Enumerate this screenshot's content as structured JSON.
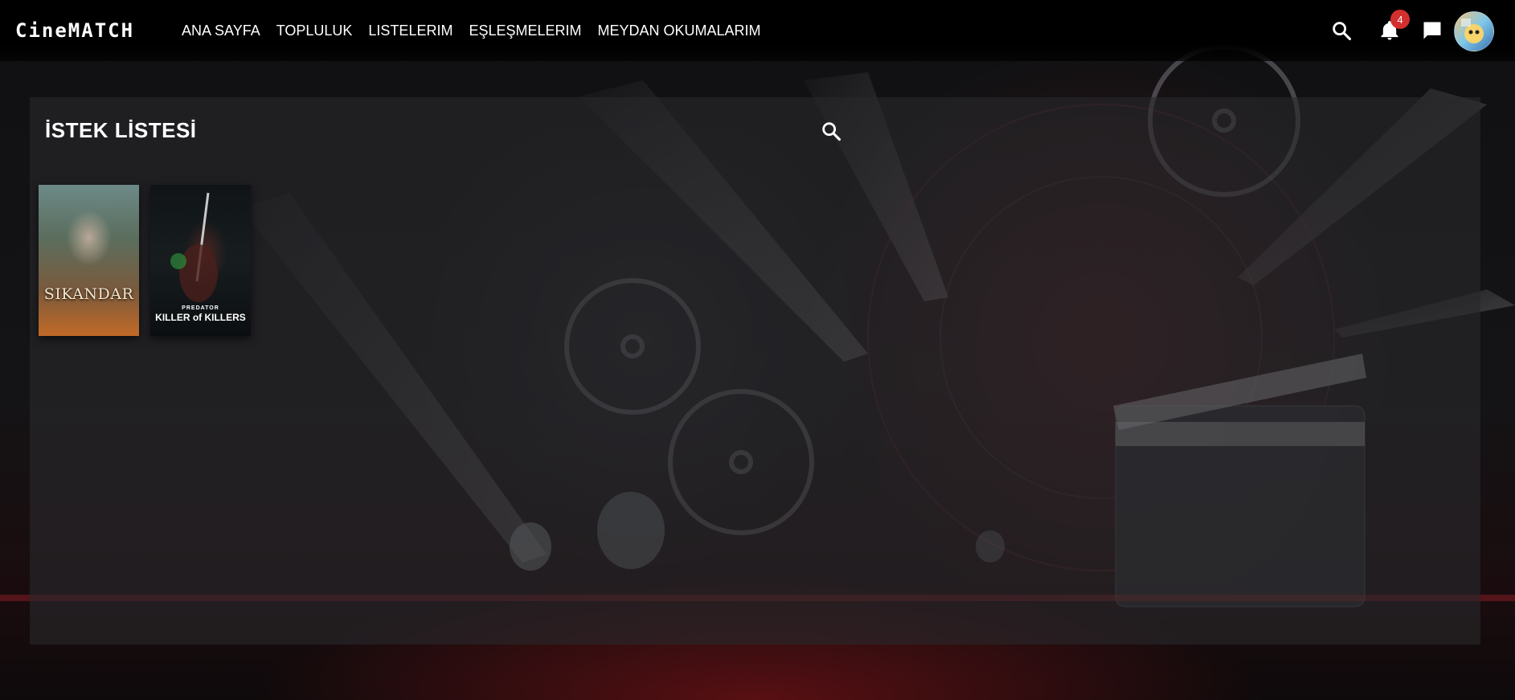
{
  "app": {
    "logo": "CineMATCH"
  },
  "nav": {
    "items": [
      {
        "label": "ANA SAYFA"
      },
      {
        "label": "TOPLULUK"
      },
      {
        "label": "LISTELERIM"
      },
      {
        "label": "EŞLEŞMELERIM"
      },
      {
        "label": "MEYDAN OKUMALARIM"
      }
    ],
    "icons": [
      "search-icon",
      "notification-bell-icon",
      "chat-icon",
      "user-avatar"
    ],
    "notification_count": "4"
  },
  "panel": {
    "title": "İSTEK LİSTESİ",
    "search_icon": "search-icon",
    "posters": [
      {
        "title": "SIKANDAR"
      },
      {
        "kicker": "PREDATOR",
        "title": "KILLER of KILLERS"
      }
    ]
  },
  "colors": {
    "navbar": "#000000",
    "badge": "#d32f2f",
    "panel": "#28282c",
    "text": "#ffffff"
  }
}
